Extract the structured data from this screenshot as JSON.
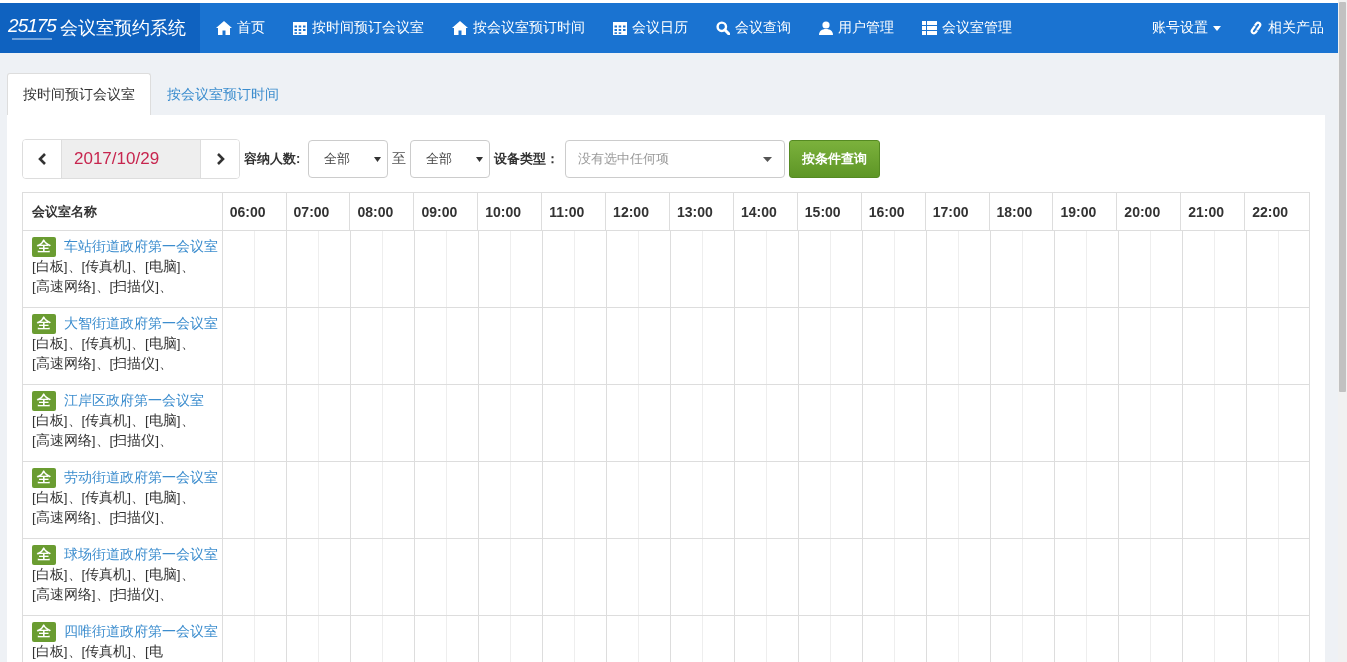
{
  "brand": {
    "title": "会议室预约系统",
    "logo_text": "25175"
  },
  "nav": [
    {
      "kind": "home",
      "label": "首页"
    },
    {
      "kind": "calendar",
      "label": "按时间预订会议室"
    },
    {
      "kind": "home",
      "label": "按会议室预订时间"
    },
    {
      "kind": "calendar",
      "label": "会议日历"
    },
    {
      "kind": "search",
      "label": "会议查询"
    },
    {
      "kind": "user",
      "label": "用户管理"
    },
    {
      "kind": "grid",
      "label": "会议室管理"
    }
  ],
  "nav_right": [
    {
      "kind": "dropdown",
      "label": "账号设置"
    },
    {
      "kind": "link",
      "label": "相关产品"
    }
  ],
  "tabs": [
    {
      "label": "按时间预订会议室",
      "selected": true
    },
    {
      "label": "按会议室预订时间",
      "selected": false
    }
  ],
  "filter": {
    "date": "2017/10/29",
    "capacity_label": "容纳人数:",
    "capacity_from": "全部",
    "to_label": "至",
    "capacity_to": "全部",
    "equipment_label": "设备类型：",
    "equipment_placeholder": "没有选中任何项",
    "query_button": "按条件查询"
  },
  "table": {
    "name_column": "会议室名称",
    "hours": [
      "06:00",
      "07:00",
      "08:00",
      "09:00",
      "10:00",
      "11:00",
      "12:00",
      "13:00",
      "14:00",
      "15:00",
      "16:00",
      "17:00",
      "18:00",
      "19:00",
      "20:00",
      "21:00",
      "22:00"
    ],
    "rows": [
      {
        "badge": "全",
        "name": "车站街道政府第一会议室",
        "equipment": "[白板]、[传真机]、[电脑]、[高速网络]、[扫描仪]、"
      },
      {
        "badge": "全",
        "name": "大智街道政府第一会议室",
        "equipment": "[白板]、[传真机]、[电脑]、[高速网络]、[扫描仪]、"
      },
      {
        "badge": "全",
        "name": "江岸区政府第一会议室",
        "equipment": "[白板]、[传真机]、[电脑]、[高速网络]、[扫描仪]、"
      },
      {
        "badge": "全",
        "name": "劳动街道政府第一会议室",
        "equipment": "[白板]、[传真机]、[电脑]、[高速网络]、[扫描仪]、"
      },
      {
        "badge": "全",
        "name": "球场街道政府第一会议室",
        "equipment": "[白板]、[传真机]、[电脑]、[高速网络]、[扫描仪]、"
      },
      {
        "badge": "全",
        "name": "四唯街道政府第一会议室",
        "equipment": "[白板]、[传真机]、[电"
      }
    ]
  }
}
